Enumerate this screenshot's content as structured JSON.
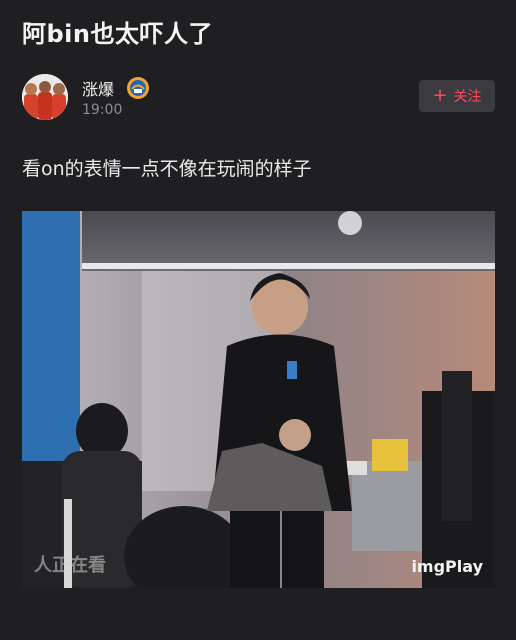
{
  "post": {
    "title": "阿bin也太吓人了",
    "author": {
      "name": "涨爆",
      "time": "19:00",
      "avatar_icon": "basketball-team-avatar-icon",
      "badge_icon": "team-badge-icon"
    },
    "follow_button": {
      "label": "关注",
      "icon": "plus-icon",
      "color": "#ff4b5c"
    },
    "content_text": "看on的表情一点不像在玩闹的样子",
    "media": {
      "type": "gif",
      "overlay_text": "人正在看",
      "watermark": "imgPlay"
    }
  },
  "colors": {
    "background": "#1f1f22",
    "accent": "#ff4b5c",
    "button_bg": "#3a3a3f",
    "muted_text": "#8e8e93"
  }
}
